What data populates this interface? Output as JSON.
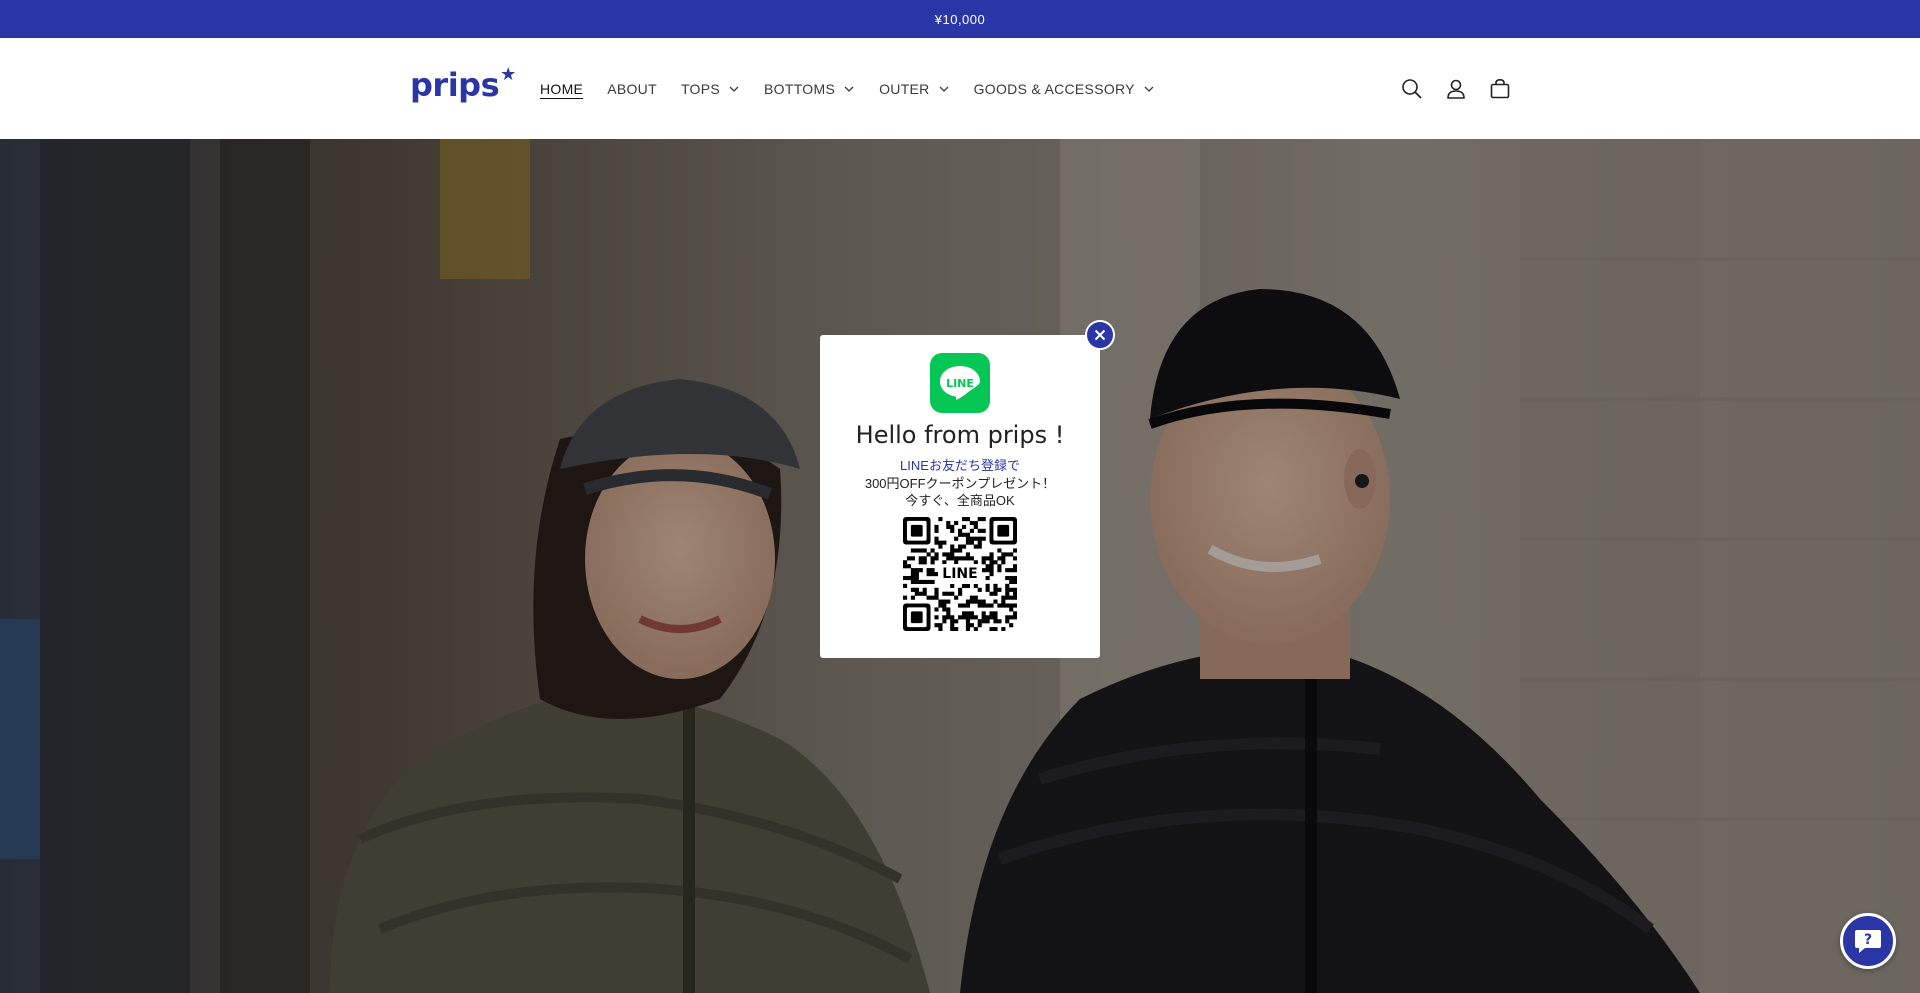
{
  "announcement": {
    "text": "¥10,000"
  },
  "header": {
    "logo": "prips",
    "logo_star": "★",
    "nav": [
      {
        "label": "HOME",
        "active": true,
        "dropdown": false
      },
      {
        "label": "ABOUT",
        "active": false,
        "dropdown": false
      },
      {
        "label": "TOPS",
        "active": false,
        "dropdown": true
      },
      {
        "label": "BOTTOMS",
        "active": false,
        "dropdown": true
      },
      {
        "label": "OUTER",
        "active": false,
        "dropdown": true
      },
      {
        "label": "GOODS & ACCESSORY",
        "active": false,
        "dropdown": true
      }
    ],
    "icons": [
      "search-icon",
      "account-icon",
      "cart-icon"
    ]
  },
  "popup": {
    "badge": "LINE",
    "title": "Hello from prips !",
    "line1": "LINEお友だち登録で",
    "line2": "300円OFFクーポンプレゼント！",
    "line3": "今すぐ、全商品OK",
    "qr_label": "LINE"
  },
  "colors": {
    "brand": "#2b36a6",
    "line_green": "#06c755"
  }
}
